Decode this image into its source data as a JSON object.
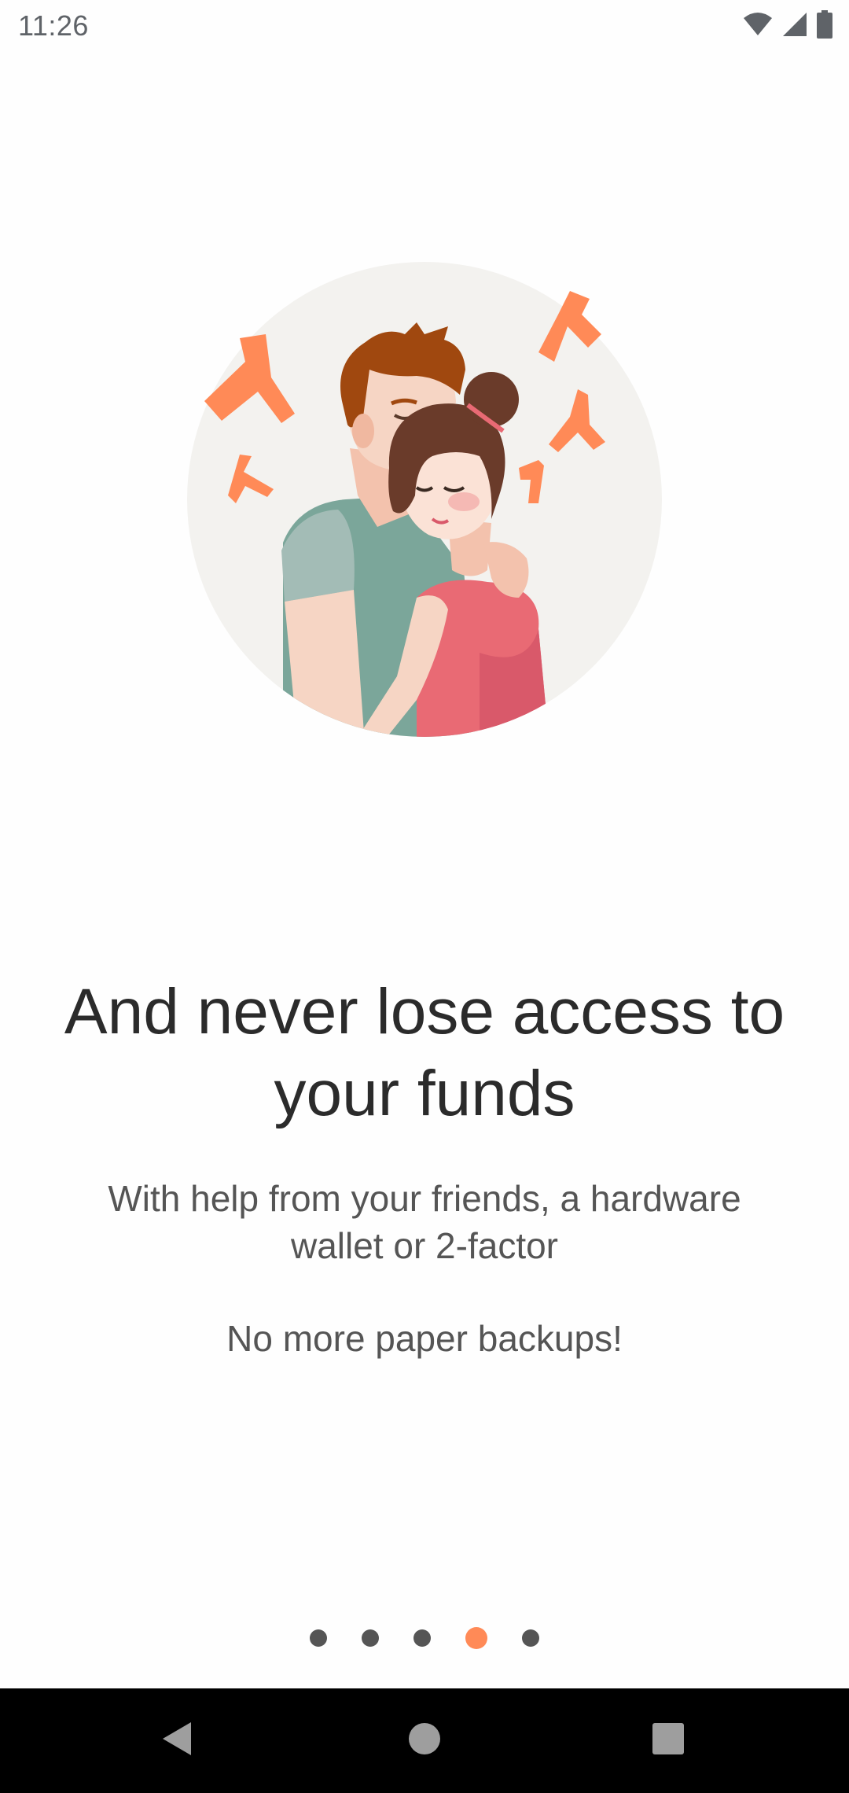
{
  "status_bar": {
    "time": "11:26",
    "icons": [
      "wifi-icon",
      "cellular-signal-icon",
      "battery-icon"
    ]
  },
  "onboarding": {
    "headline": "And never lose access to your funds",
    "description": "With help from your friends, a hardware wallet or 2-factor",
    "tagline": "No more paper backups!",
    "page_count": 5,
    "current_page": 4
  },
  "colors": {
    "accent": "#ff8a57",
    "dot_inactive": "#555555",
    "headline": "#2b2b2b",
    "body_text": "#555555",
    "nav_bar": "#000000"
  },
  "nav_bar": {
    "icons": [
      "back-icon",
      "home-icon",
      "recents-icon"
    ]
  }
}
